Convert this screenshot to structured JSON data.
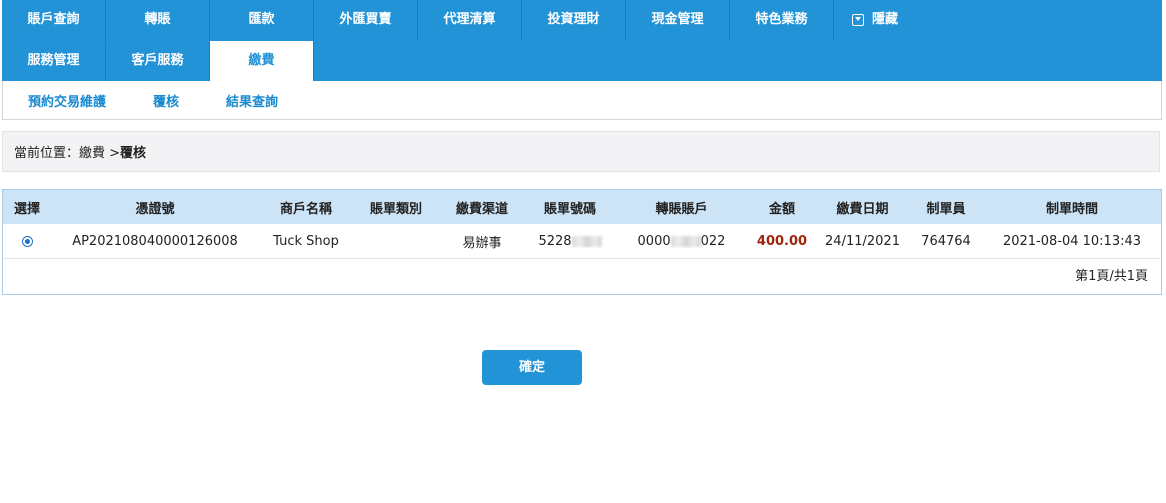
{
  "nav": {
    "row1": [
      "賬戶查詢",
      "轉賬",
      "匯款",
      "外匯買賣",
      "代理清算",
      "投資理財",
      "現金管理",
      "特色業務"
    ],
    "hide_label": "隱藏",
    "row2": [
      "服務管理",
      "客戶服務",
      "繳費"
    ],
    "active": "繳費"
  },
  "subnav": [
    "預約交易維護",
    "覆核",
    "結果查詢"
  ],
  "breadcrumb": {
    "prefix": "當前位置：繳費 > ",
    "current": "覆核"
  },
  "table": {
    "headers": [
      "選擇",
      "憑證號",
      "商戶名稱",
      "賬單類別",
      "繳費渠道",
      "賬單號碼",
      "轉賬賬戶",
      "金額",
      "繳費日期",
      "制單員",
      "制單時間"
    ],
    "rows": [
      {
        "voucher": "AP202108040000126008",
        "merchant": "Tuck Shop",
        "bill_type": "",
        "channel": "易辦事",
        "bill_no_prefix": "5228",
        "account_prefix": "0000",
        "account_suffix": "022",
        "amount": "400.00",
        "pay_date": "24/11/2021",
        "operator": "764764",
        "created": "2021-08-04 10:13:43"
      }
    ],
    "pager": "第1頁/共1頁"
  },
  "confirm_label": "確定",
  "colors": {
    "nav_bg": "#2293d6",
    "header_bg": "#cde4f7",
    "amount": "#a0260f"
  }
}
